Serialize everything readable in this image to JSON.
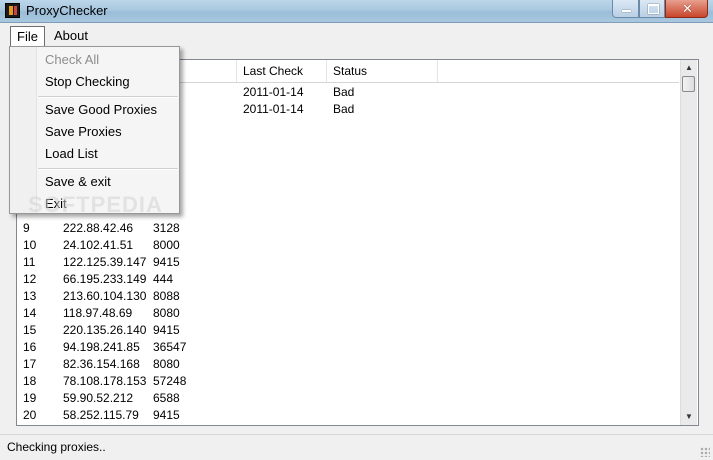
{
  "window": {
    "title": "ProxyChecker",
    "close_symbol": "✕"
  },
  "menubar": {
    "file": "File",
    "about": "About"
  },
  "file_menu": {
    "items": [
      {
        "label": "Check All",
        "enabled": false
      },
      {
        "label": "Stop Checking",
        "enabled": true
      },
      {
        "label": "Save Good Proxies",
        "enabled": true
      },
      {
        "label": "Save Proxies",
        "enabled": true
      },
      {
        "label": "Load List",
        "enabled": true
      },
      {
        "label": "Save & exit",
        "enabled": true
      },
      {
        "label": "Exit",
        "enabled": true
      }
    ]
  },
  "list": {
    "columns": {
      "last_check": "Last Check",
      "status": "Status"
    },
    "partial_rows": [
      {
        "last_check": "2011-01-14",
        "status": "Bad"
      },
      {
        "last_check": "2011-01-14",
        "status": "Bad"
      }
    ],
    "rows": [
      {
        "num": "9",
        "ip": "222.88.42.46",
        "port": "3128"
      },
      {
        "num": "10",
        "ip": "24.102.41.51",
        "port": "8000"
      },
      {
        "num": "11",
        "ip": "122.125.39.147",
        "port": "9415"
      },
      {
        "num": "12",
        "ip": "66.195.233.149",
        "port": "444"
      },
      {
        "num": "13",
        "ip": "213.60.104.130",
        "port": "8088"
      },
      {
        "num": "14",
        "ip": "118.97.48.69",
        "port": "8080"
      },
      {
        "num": "15",
        "ip": "220.135.26.140",
        "port": "9415"
      },
      {
        "num": "16",
        "ip": "94.198.241.85",
        "port": "36547"
      },
      {
        "num": "17",
        "ip": "82.36.154.168",
        "port": "8080"
      },
      {
        "num": "18",
        "ip": "78.108.178.153",
        "port": "57248"
      },
      {
        "num": "19",
        "ip": "59.90.52.212",
        "port": "6588"
      },
      {
        "num": "20",
        "ip": "58.252.115.79",
        "port": "9415"
      }
    ]
  },
  "statusbar": {
    "text": "Checking proxies.."
  },
  "watermark": "SOFTPEDIA"
}
